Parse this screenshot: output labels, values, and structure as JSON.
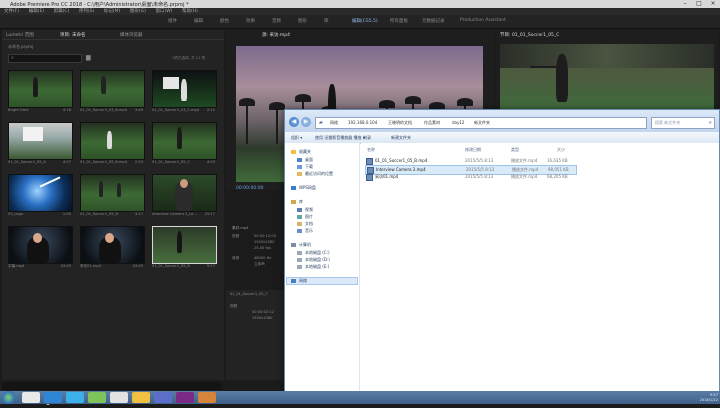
{
  "app": {
    "title": "Adobe Premiere Pro CC 2018 - C:\\用户\\Administrator\\桌面\\未命名.prproj *",
    "controls": [
      "–",
      "□",
      "×"
    ]
  },
  "menu": [
    "文件(F)",
    "编辑(E)",
    "剪辑(C)",
    "序列(S)",
    "标记(M)",
    "图形(G)",
    "窗口(W)",
    "帮助(H)"
  ],
  "workspaces": {
    "items": [
      "组件",
      "编辑",
      "颜色",
      "效果",
      "音频",
      "图形",
      "库",
      "编辑(CS5.5)",
      "所有面板",
      "元数据记录",
      "Production Assistant"
    ],
    "active": "编辑(CS5.5)"
  },
  "project": {
    "tabs": [
      "Lumetri 范围",
      "项目: 未命名",
      "媒体浏览器"
    ],
    "path": "未命名.prproj",
    "count": "1项已选择, 共 12 项",
    "clips": [
      {
        "name": "Bright Dark",
        "dur": "4:18"
      },
      {
        "name": "01_01_Soccer1_03_B.mp4",
        "dur": "3:49"
      },
      {
        "name": "01_01_Soccer1_03_C.mp4",
        "dur": "2:12"
      },
      {
        "name": "01_01_Soccer1_05_A",
        "dur": "4:07"
      },
      {
        "name": "01_01_Soccer1_05_B.mp4",
        "dur": "2:23"
      },
      {
        "name": "01_01_Soccer1_05_C",
        "dur": "4:03"
      },
      {
        "name": "03_Logo",
        "dur": "1:00"
      },
      {
        "name": "01_01_Soccer1_05_D",
        "dur": "3:17"
      },
      {
        "name": "Interview Camera 2_Le...",
        "dur": "25:17"
      },
      {
        "name": "字幕.mp4",
        "dur": "43:05"
      },
      {
        "name": "采访01.mp4",
        "dur": "43:05"
      },
      {
        "name": "01_01_Soccer1_05_B",
        "dur": "9:17"
      }
    ]
  },
  "source": {
    "tab": "源: 采访.mp4",
    "timecode": "00:00:00:00",
    "meta": [
      "素材.mp4",
      "视频",
      "00:00:12:03",
      "1920x1080",
      "25.00 fps",
      "音频",
      "48000 Hz",
      "立体声"
    ]
  },
  "program": {
    "tab": "节目: 01_01_Soccer1_05_C"
  },
  "effects": {
    "items": [
      "01_01_Soccer1_05_C",
      "视频",
      "00:00:02:12",
      "1920x1080"
    ]
  },
  "explorer": {
    "breadcrumb": [
      "网络",
      "192.168.0.104",
      "王晓明的文档",
      "作品素材",
      "day12",
      "新文件夹"
    ],
    "search_placeholder": "搜索 新文件夹",
    "toolbar": [
      "组织 ▾",
      "使用 迅雷影音播放器 播放 ▾",
      "刻录",
      "新建文件夹"
    ],
    "nav": {
      "favorites_header": "收藏夹",
      "favorites": [
        "桌面",
        "下载",
        "最近访问的位置"
      ],
      "cloud": "WPS网盘",
      "libraries_header": "库",
      "libraries": [
        "视频",
        "图片",
        "文档",
        "音乐"
      ],
      "computer_header": "计算机",
      "drives": [
        "本地磁盘 (C:)",
        "本地磁盘 (D:)",
        "本地磁盘 (E:)"
      ],
      "network": "网络"
    },
    "columns": [
      "名称",
      "修改日期",
      "类型",
      "大小"
    ],
    "files": [
      {
        "name": "01_01_Soccer1_05_B.mp4",
        "date": "2015/5/5 8:13",
        "type": "播放文件.mp4",
        "size": "16,635 KB"
      },
      {
        "name": "Interview Camera 2.mp4",
        "date": "2015/5/5 8:13",
        "type": "播放文件.mp4",
        "size": "98,051 KB"
      },
      {
        "name": "采访01.mp4",
        "date": "2015/5/5 8:13",
        "type": "播放文件.mp4",
        "size": "68,205 KB"
      }
    ]
  },
  "taskbar": {
    "tray_time": "9:57",
    "tray_date": "2018/1/22"
  },
  "colors": {
    "premiere_bg": "#1b1b1b",
    "workspace_active": "#8fb6e8",
    "explorer_selection": "#d9eaf9",
    "taskbar": "#3e5f88"
  }
}
